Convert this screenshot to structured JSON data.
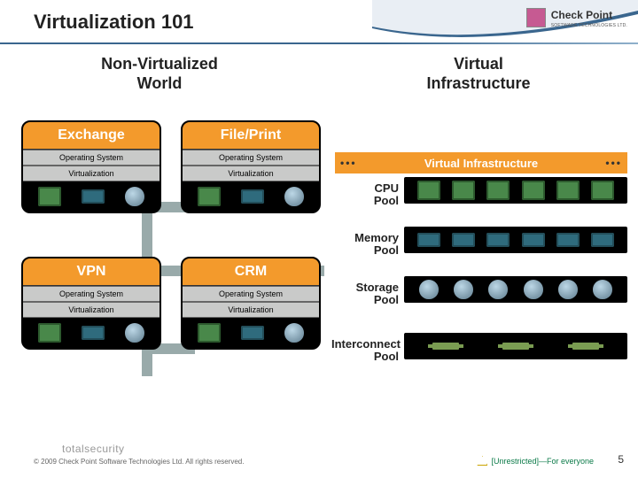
{
  "header": {
    "title": "Virtualization 101",
    "brand_name": "Check Point",
    "brand_sub": "SOFTWARE TECHNOLOGIES LTD."
  },
  "columns": {
    "left": "Non-Virtualized\nWorld",
    "right": "Virtual\nInfrastructure"
  },
  "stacks": {
    "exchange": {
      "title": "Exchange",
      "os": "Operating System",
      "virt": "Virtualization"
    },
    "fileprint": {
      "title": "File/Print",
      "os": "Operating System",
      "virt": "Virtualization"
    },
    "vpn": {
      "title": "VPN",
      "os": "Operating System",
      "virt": "Virtualization"
    },
    "crm": {
      "title": "CRM",
      "os": "Operating System",
      "virt": "Virtualization"
    }
  },
  "vi": {
    "band": "Virtual Infrastructure",
    "pools": {
      "cpu": "CPU\nPool",
      "memory": "Memory\nPool",
      "storage": "Storage\nPool",
      "interconnect": "Interconnect\nPool"
    }
  },
  "footer": {
    "copyright": "© 2009 Check Point Software Technologies Ltd. All rights reserved.",
    "logo_text": "totalsecurity",
    "classification": "[Unrestricted]—For everyone",
    "slide_number": "5"
  },
  "colors": {
    "accent": "#f39a2c"
  }
}
